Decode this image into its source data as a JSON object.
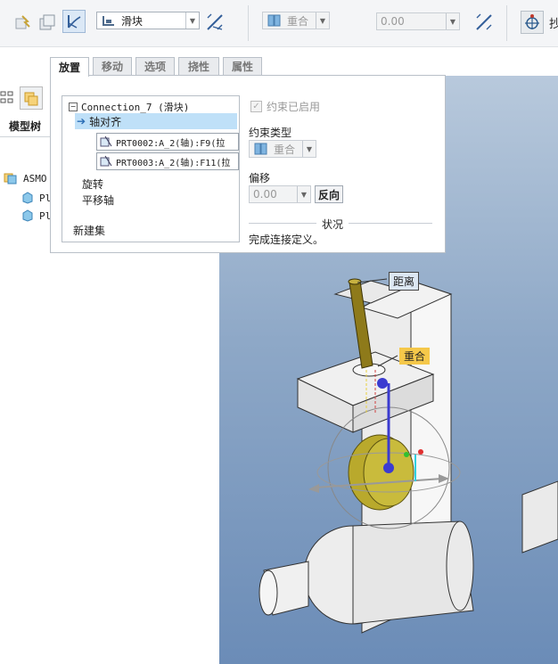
{
  "toolbar": {
    "connection_type": "滑块",
    "constraint_type": "重合",
    "offset_value": "0.00",
    "far_right_partial": "抄"
  },
  "tabs": [
    {
      "label": "放置",
      "active": true
    },
    {
      "label": "移动",
      "active": false
    },
    {
      "label": "选项",
      "active": false
    },
    {
      "label": "挠性",
      "active": false
    },
    {
      "label": "属性",
      "active": false
    }
  ],
  "placement": {
    "connection_name": "Connection_7 (滑块)",
    "selected_item": "轴对齐",
    "reference_1": "PRT0002:A_2(轴):F9(拉",
    "reference_2": "PRT0003:A_2(轴):F11(拉",
    "item_rotate": "旋转",
    "item_translate_axis": "平移轴",
    "new_set": "新建集",
    "constraint_enabled_label": "约束已启用",
    "constraint_type_label": "约束类型",
    "constraint_type_value": "重合",
    "offset_label": "偏移",
    "offset_value": "0.00",
    "flip_button": "反向",
    "status_header": "状况",
    "status_text": "完成连接定义。"
  },
  "left_pane": {
    "model_tree_tab": "模型树",
    "root": "ASMO",
    "child_1": "Pl",
    "child_2": "Pl"
  },
  "viewport": {
    "label_distance": "距离",
    "label_coincident": "重合"
  },
  "colors": {
    "accent_blue": "#3a7fc4",
    "selection_bg": "#bfe0f8",
    "label_yellow": "#f5c84a"
  }
}
